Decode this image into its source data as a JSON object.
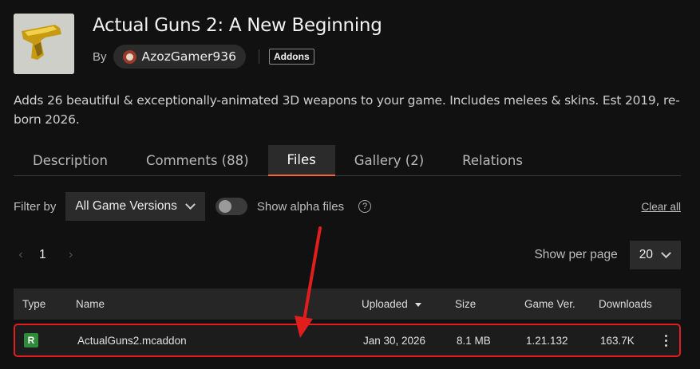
{
  "mod": {
    "title": "Actual Guns 2: A New Beginning",
    "by_label": "By",
    "author": "AzozGamer936",
    "tag": "Addons",
    "thumbnail_icon": "golden-pistol-icon",
    "description": "Adds 26 beautiful & exceptionally-animated 3D weapons to your game. Includes melees & skins. Est 2019, re-born 2026."
  },
  "tabs": [
    {
      "label": "Description",
      "active": false
    },
    {
      "label": "Comments (88)",
      "active": false
    },
    {
      "label": "Files",
      "active": true
    },
    {
      "label": "Gallery (2)",
      "active": false
    },
    {
      "label": "Relations",
      "active": false
    }
  ],
  "filters": {
    "filter_label": "Filter by",
    "game_version_selected": "All Game Versions",
    "alpha_label": "Show alpha files",
    "alpha_enabled": false,
    "help_glyph": "?",
    "clear_all": "Clear all"
  },
  "pagination": {
    "prev_glyph": "‹",
    "next_glyph": "›",
    "current_page": "1",
    "per_page_label": "Show per page",
    "per_page_value": "20"
  },
  "table": {
    "headers": {
      "type": "Type",
      "name": "Name",
      "uploaded": "Uploaded",
      "size": "Size",
      "game_ver": "Game Ver.",
      "downloads": "Downloads"
    },
    "rows": [
      {
        "type": "R",
        "name": "ActualGuns2.mcaddon",
        "uploaded": "Jan 30, 2026",
        "size": "8.1 MB",
        "game_ver": "1.21.132",
        "downloads": "163.7K"
      }
    ]
  },
  "colors": {
    "background": "#111111",
    "tab_active_underline": "#f16436",
    "highlight_border": "#e01e1e",
    "release_badge": "#2e8b3a"
  }
}
